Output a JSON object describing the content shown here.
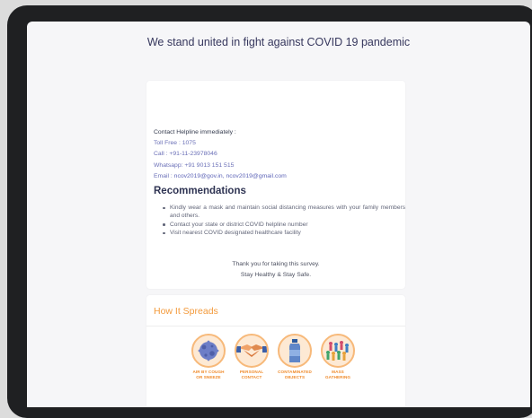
{
  "header": {
    "headline": "We stand united in fight against COVID 19 pandemic"
  },
  "contact": {
    "heading": "Contact Helpline immediately :",
    "toll_free": "Toll Free : 1075",
    "call": "Call : +91-11-23978046",
    "whatsapp": "Whatsapp: +91 9013 151 515",
    "email_label": "Email :",
    "email_value": "ncov2019@gov.in, ncov2019@gmail.com"
  },
  "recommendations": {
    "title": "Recommendations",
    "items": [
      "Kindly wear a mask and maintain social distancing measures with your family members and others.",
      "Contact your state or district COVID helpline number",
      "Visit nearest COVID designated healthcare facility"
    ]
  },
  "thanks": {
    "line1": "Thank you for taking this survey.",
    "line2": "Stay Healthy & Stay Safe."
  },
  "spread": {
    "title": "How It Spreads",
    "icons": [
      {
        "icon": "virus-icon",
        "label": "AIR BY COUGH OR SNEEZE"
      },
      {
        "icon": "handshake-icon",
        "label": "PERSONAL CONTACT"
      },
      {
        "icon": "bottle-icon",
        "label": "CONTAMINATED OBJECTS"
      },
      {
        "icon": "crowd-icon",
        "label": "MASS GATHERING"
      }
    ]
  },
  "colors": {
    "accent_orange": "#f39a3b",
    "link_blue": "#5f66b8",
    "title_navy": "#2f3453"
  }
}
